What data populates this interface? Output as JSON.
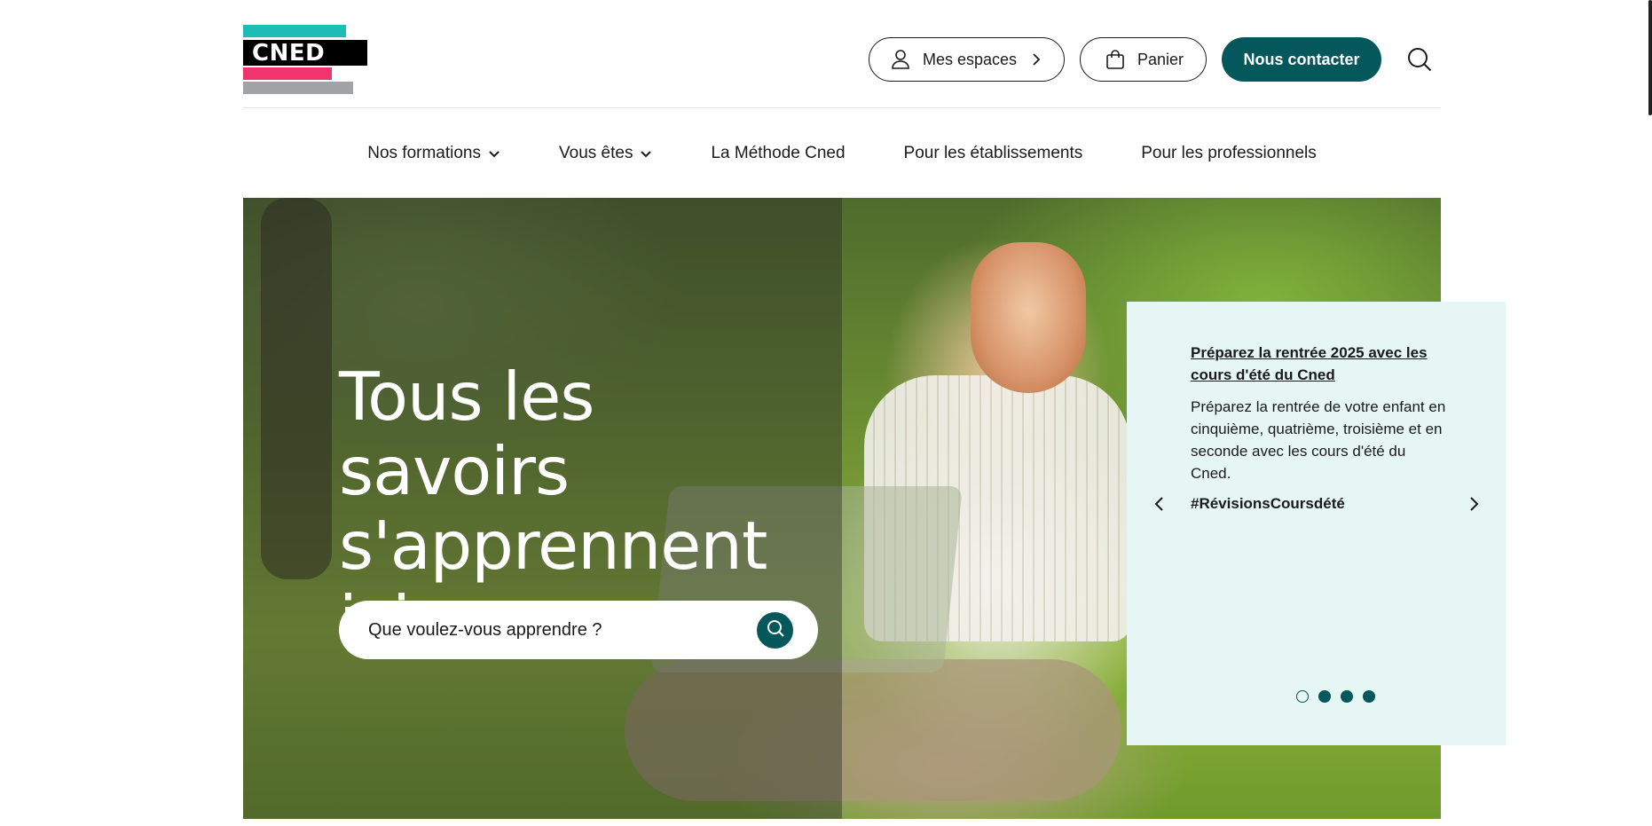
{
  "header": {
    "logo_text": "CNED",
    "espaces_label": "Mes espaces",
    "panier_label": "Panier",
    "contact_label": "Nous contacter"
  },
  "nav": {
    "items": [
      {
        "label": "Nos formations"
      },
      {
        "label": "Vous êtes"
      },
      {
        "label": "La Méthode Cned"
      },
      {
        "label": "Pour les établissements"
      },
      {
        "label": "Pour les professionnels"
      }
    ]
  },
  "hero": {
    "title_line1": "Tous les savoirs",
    "title_line2": "s'apprennent ici",
    "search_placeholder": "Que voulez-vous apprendre ?"
  },
  "carousel": {
    "title": "Préparez la rentrée 2025 avec les cours d'été du Cned",
    "text": "Préparez la rentrée de votre enfant en cinquième, quatrième, troisième et en seconde avec les cours d'été du Cned.",
    "tag": "#RévisionsCoursdété",
    "active_slide": 1,
    "slide_count": 4
  },
  "colors": {
    "accent": "#04575a",
    "logo_teal": "#1dbdb5",
    "logo_pink": "#f0346e",
    "logo_grey": "#a0a4a6",
    "card_bg": "#e5f6f5"
  },
  "icons": [
    "user-icon",
    "chevron-right-icon",
    "shopping-bag-icon",
    "search-icon",
    "chevron-down-icon",
    "chevron-left-icon"
  ]
}
